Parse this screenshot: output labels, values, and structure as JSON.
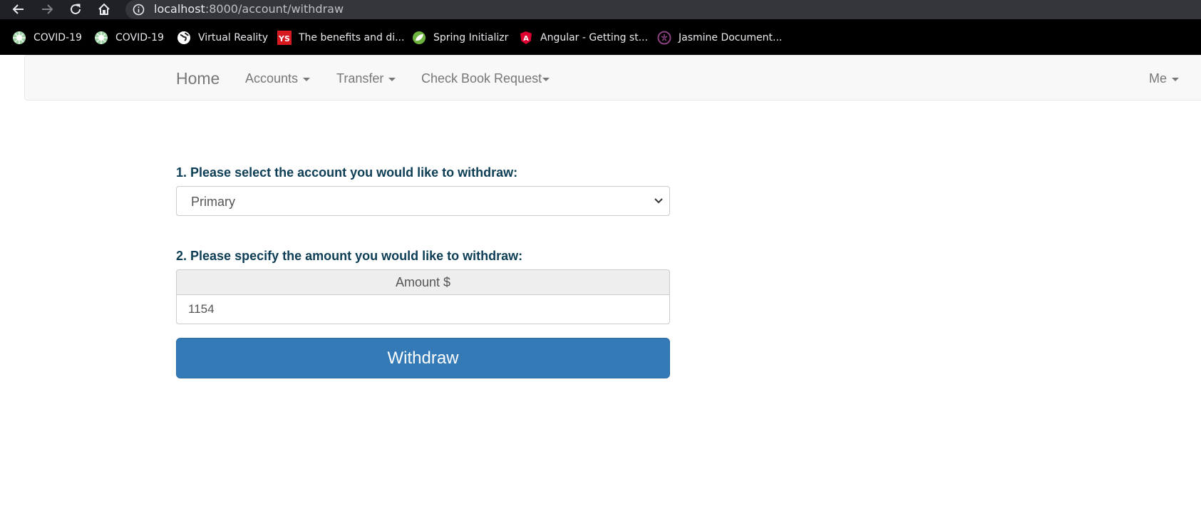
{
  "browser": {
    "nav_icons": [
      "back-arrow-icon",
      "forward-arrow-icon",
      "reload-icon",
      "home-icon"
    ],
    "url_host": "localhost",
    "url_path": ":8000/account/withdraw",
    "bookmarks": [
      {
        "label": "COVID-19",
        "icon": "covid-icon"
      },
      {
        "label": "COVID-19",
        "icon": "covid-icon"
      },
      {
        "label": "Virtual Reality",
        "icon": "globe-icon"
      },
      {
        "label": "The benefits and di...",
        "icon": "ys-icon"
      },
      {
        "label": "Spring Initializr",
        "icon": "spring-leaf-icon"
      },
      {
        "label": "Angular - Getting st...",
        "icon": "angular-icon"
      },
      {
        "label": "Jasmine Document...",
        "icon": "jasmine-icon"
      }
    ]
  },
  "navbar": {
    "brand": "Home",
    "items": [
      {
        "label": "Accounts"
      },
      {
        "label": "Transfer"
      },
      {
        "label": "Check Book Request"
      }
    ],
    "user": "Me"
  },
  "form": {
    "step1_label": "1. Please select the account you would like to withdraw:",
    "account_selected": "Primary",
    "step2_label": "2. Please specify the amount you would like to withdraw:",
    "amount_addon": "Amount $",
    "amount_value": "1154",
    "submit_label": "Withdraw"
  },
  "colors": {
    "primary_button": "#337ab7",
    "label_text": "#0d3e56",
    "navbar_bg": "#f8f8f8",
    "chrome_bg": "#202124"
  }
}
